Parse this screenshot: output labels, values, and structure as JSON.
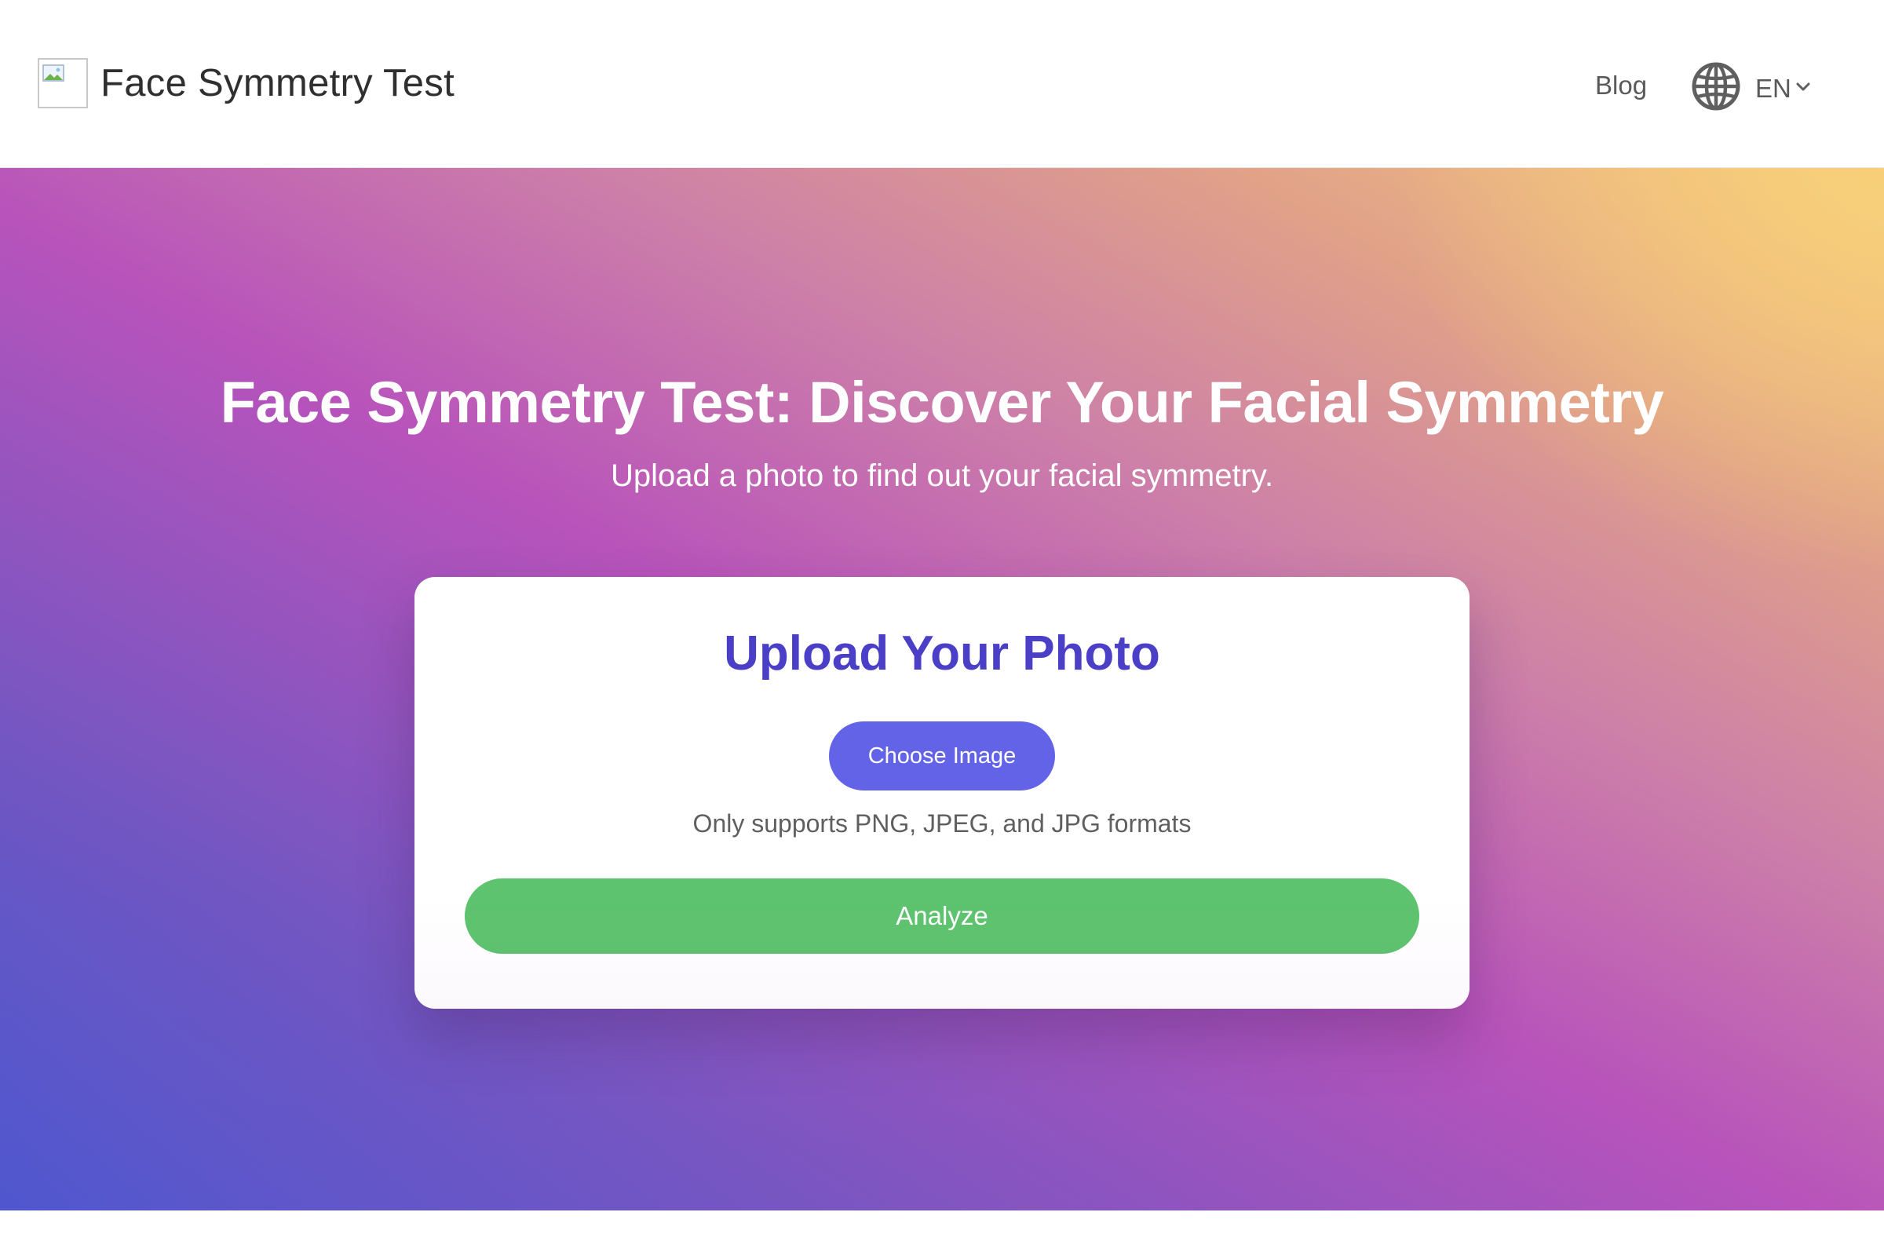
{
  "header": {
    "brand_title": "Face Symmetry Test",
    "logo_icon": "broken-image-icon",
    "nav": {
      "blog_label": "Blog"
    },
    "language": {
      "icon": "globe-icon",
      "current": "EN",
      "chevron_icon": "chevron-down-icon"
    }
  },
  "hero": {
    "title": "Face Symmetry Test: Discover Your Facial Symmetry",
    "subtitle": "Upload a photo to find out your facial symmetry."
  },
  "upload_card": {
    "title": "Upload Your Photo",
    "choose_button_label": "Choose Image",
    "formats_note": "Only supports PNG, JPEG, and JPG formats",
    "analyze_button_label": "Analyze"
  },
  "colors": {
    "card_title": "#4a3fc6",
    "choose_button": "#6263e6",
    "analyze_button": "#5dc36e",
    "gradient_start": "#4458d0",
    "gradient_mid": "#b853bb",
    "gradient_end": "#f3c67f"
  }
}
